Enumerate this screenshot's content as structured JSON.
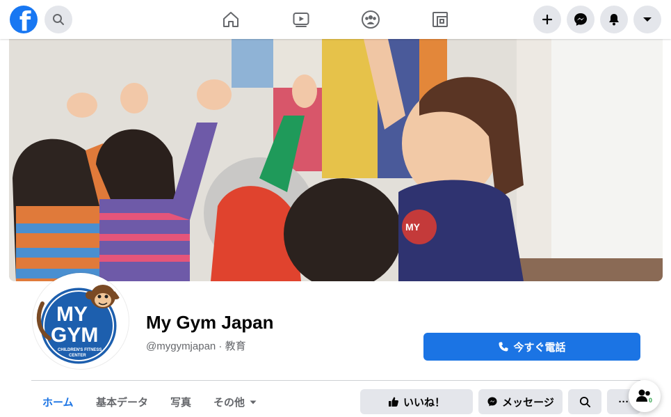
{
  "topbar": {
    "logo_letter": "f",
    "icons": [
      "facebook-logo",
      "search-icon",
      "home-icon",
      "watch-icon",
      "groups-icon",
      "gaming-icon",
      "plus-icon",
      "messenger-icon",
      "bell-icon",
      "caret-down-icon"
    ]
  },
  "page": {
    "name": "My Gym Japan",
    "meta": "@mygymjapan · 教育",
    "avatar_logo_lines": [
      "MY",
      "GYM",
      "CHILDREN'S FITNESS",
      "CENTER"
    ],
    "call_button": "今すぐ電話"
  },
  "tabs": [
    {
      "label": "ホーム",
      "active": true
    },
    {
      "label": "基本データ",
      "active": false
    },
    {
      "label": "写真",
      "active": false
    },
    {
      "label": "その他",
      "active": false
    }
  ],
  "actions": {
    "like": "いいね！",
    "message": "メッセージ",
    "more": "···",
    "people_badge": "0"
  },
  "colors": {
    "brand_blue": "#1877f2",
    "button_blue": "#1b74e4",
    "button_gray": "#e4e6eb",
    "secondary_text": "#65676b"
  }
}
